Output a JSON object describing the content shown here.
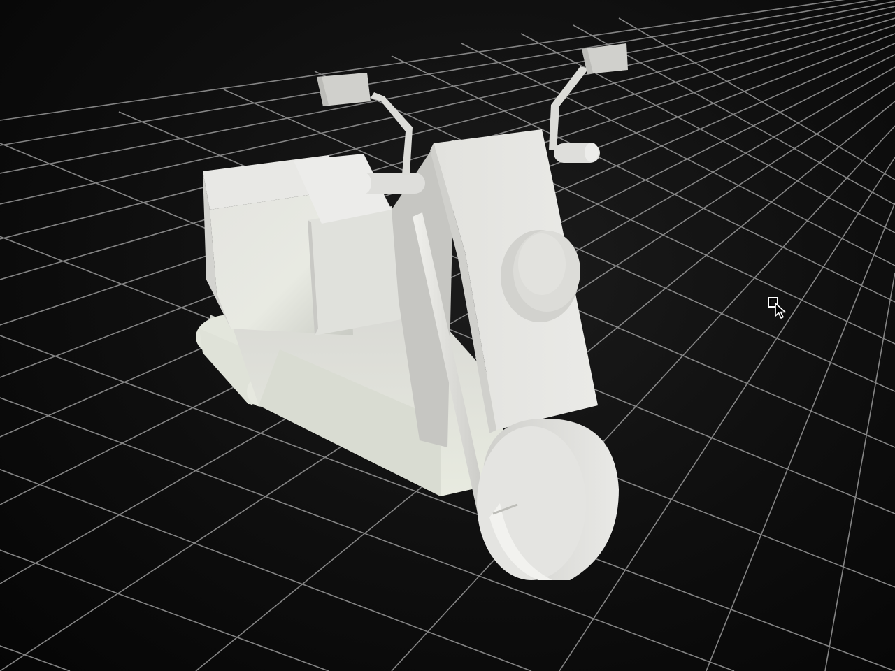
{
  "viewport": {
    "background_color": "#0a0a0a",
    "grid_line_color": "#9a9a9a",
    "model_color": "#e6e6e2",
    "model_shadow_color": "#bdbdb8"
  },
  "scene": {
    "object": "motorcycle-model",
    "render_style": "untextured-gray-shading",
    "ground": "perspective-grid"
  },
  "cursor": {
    "icon": "select-arrow-cursor-icon"
  }
}
